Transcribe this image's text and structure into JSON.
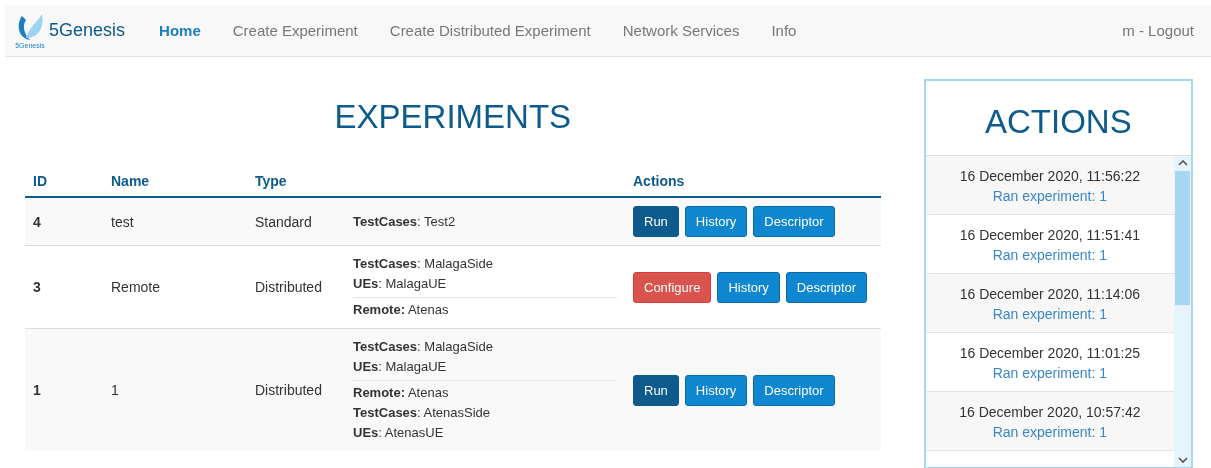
{
  "navbar": {
    "brand": "5Genesis",
    "logo_caption": "5Genesis",
    "items": [
      {
        "label": "Home",
        "selected": true
      },
      {
        "label": "Create Experiment",
        "selected": false
      },
      {
        "label": "Create Distributed Experiment",
        "selected": false
      },
      {
        "label": "Network Services",
        "selected": false
      },
      {
        "label": "Info",
        "selected": false
      }
    ],
    "user": "m - Logout"
  },
  "experiments": {
    "title": "EXPERIMENTS",
    "columns": [
      "ID",
      "Name",
      "Type",
      "Actions"
    ],
    "rows": [
      {
        "id": "4",
        "name": "test",
        "type": "Standard",
        "details": [
          [
            "**TestCases**: Test2"
          ]
        ],
        "buttons": [
          {
            "label": "Run",
            "kind": "primary"
          },
          {
            "label": "History",
            "kind": "info"
          },
          {
            "label": "Descriptor",
            "kind": "info"
          }
        ]
      },
      {
        "id": "3",
        "name": "Remote",
        "type": "Distributed",
        "details": [
          [
            "**TestCases**: MalagaSide",
            "**UEs**: MalagaUE"
          ],
          [
            "**Remote:** Atenas"
          ]
        ],
        "buttons": [
          {
            "label": "Configure",
            "kind": "danger"
          },
          {
            "label": "History",
            "kind": "info"
          },
          {
            "label": "Descriptor",
            "kind": "info"
          }
        ]
      },
      {
        "id": "1",
        "name": "1",
        "type": "Distributed",
        "details": [
          [
            "**TestCases**: MalagaSide",
            "**UEs**: MalagaUE"
          ],
          [
            "**Remote:** Atenas",
            "**TestCases**: AtenasSide",
            "**UEs**: AtenasUE"
          ]
        ],
        "buttons": [
          {
            "label": "Run",
            "kind": "primary"
          },
          {
            "label": "History",
            "kind": "info"
          },
          {
            "label": "Descriptor",
            "kind": "info"
          }
        ]
      }
    ]
  },
  "actions": {
    "title": "ACTIONS",
    "items": [
      {
        "time": "16 December 2020, 11:56:22",
        "text": "Ran experiment: 1"
      },
      {
        "time": "16 December 2020, 11:51:41",
        "text": "Ran experiment: 1"
      },
      {
        "time": "16 December 2020, 11:14:06",
        "text": "Ran experiment: 1"
      },
      {
        "time": "16 December 2020, 11:01:25",
        "text": "Ran experiment: 1"
      },
      {
        "time": "16 December 2020, 10:57:42",
        "text": "Ran experiment: 1"
      }
    ]
  }
}
